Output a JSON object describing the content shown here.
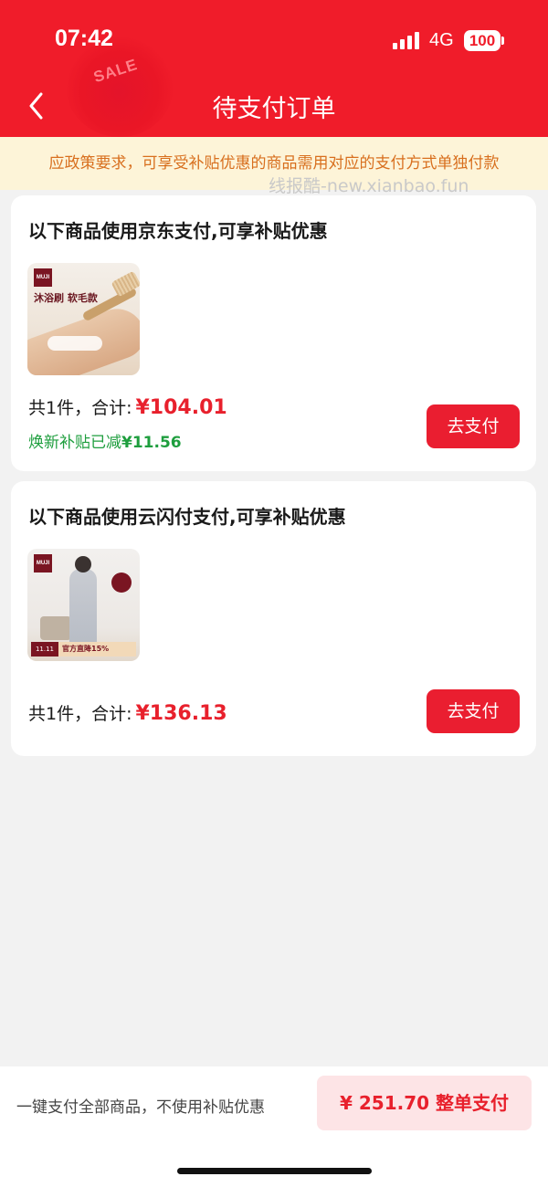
{
  "status_bar": {
    "time": "07:42",
    "network": "4G",
    "battery": "100"
  },
  "header": {
    "title": "待支付订单",
    "decoration_text": "SALE",
    "back_icon": "chevron-left-icon"
  },
  "notice": {
    "text": "应政策要求，可享受补贴优惠的商品需用对应的支付方式单独付款"
  },
  "watermark": "线报酷-new.xianbao.fun",
  "groups": [
    {
      "title": "以下商品使用京东支付,可享补贴优惠",
      "product": {
        "brand": "MUJI",
        "caption": "沐浴刷 软毛款"
      },
      "summary_label": "共1件，合计:",
      "price": "¥104.01",
      "subsidy_label": "焕新补贴已减",
      "subsidy_amount": "¥11.56",
      "pay_label": "去支付"
    },
    {
      "title": "以下商品使用云闪付支付,可享补贴优惠",
      "product": {
        "brand": "MUJI",
        "promo_tag": "11.11",
        "promo_text": "官方直降15%"
      },
      "summary_label": "共1件，合计:",
      "price": "¥136.13",
      "pay_label": "去支付"
    }
  ],
  "bottom_bar": {
    "tip": "一键支付全部商品，不使用补贴优惠",
    "pay_all_label": "¥ 251.70 整单支付"
  },
  "colors": {
    "brand_red": "#f01c2a",
    "price_red": "#e8202c",
    "subsidy_green": "#1e9e3e",
    "notice_orange": "#d86f1e",
    "notice_bg": "#fdf4d8"
  }
}
